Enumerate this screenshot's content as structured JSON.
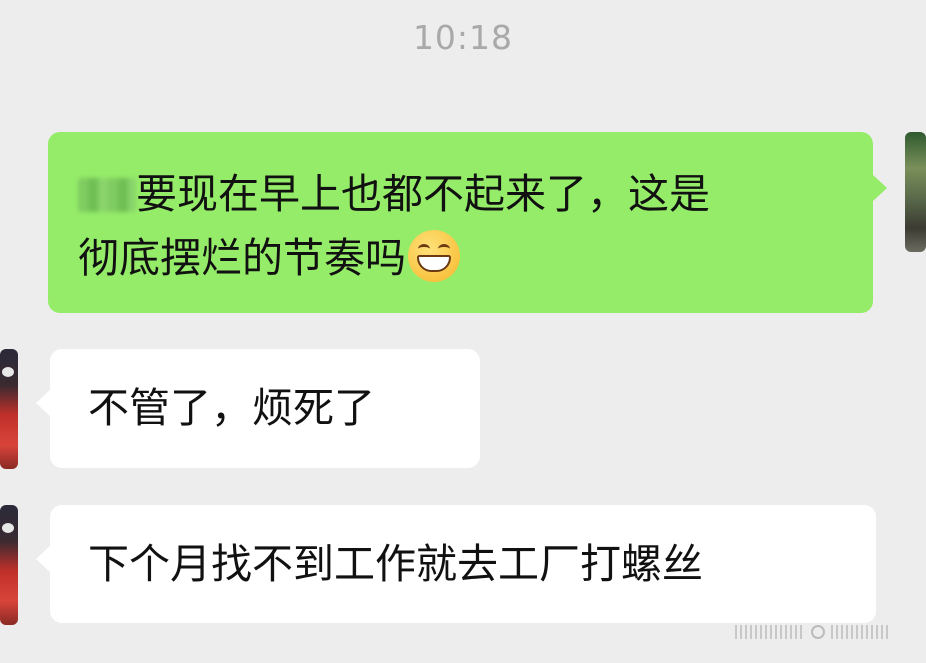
{
  "timestamp": "10:18",
  "messages": [
    {
      "direction": "outgoing",
      "line1": "要现在早上也都不起来了，这是",
      "line2": "彻底摆烂的节奏吗",
      "emoji": "grinning-face-emoji"
    },
    {
      "direction": "incoming",
      "text": "不管了，烦死了"
    },
    {
      "direction": "incoming",
      "text": "下个月找不到工作就去工厂打螺丝"
    }
  ],
  "colors": {
    "background": "#ededed",
    "outgoing_bubble": "#95ec69",
    "incoming_bubble": "#ffffff",
    "timestamp_text": "#a9a9a9"
  }
}
